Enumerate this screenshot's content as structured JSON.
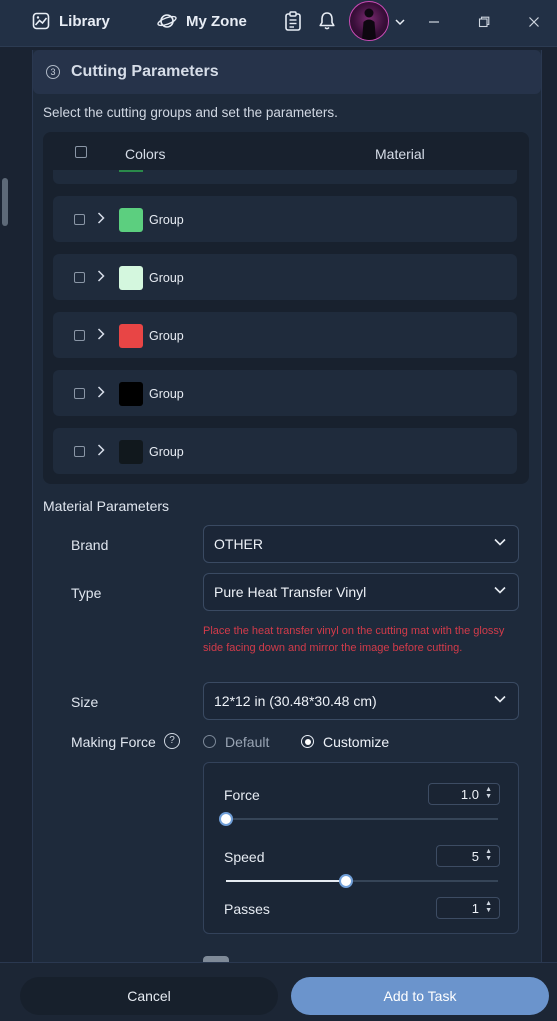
{
  "header": {
    "library_label": "Library",
    "my_zone_label": "My Zone"
  },
  "section": {
    "step_number": "3",
    "title": "Cutting Parameters",
    "description": "Select the cutting groups and set the parameters."
  },
  "table": {
    "col_colors": "Colors",
    "col_material": "Material",
    "groups": [
      {
        "label": "Group",
        "color": "#5ccf7f"
      },
      {
        "label": "Group",
        "color": "#d4f7de"
      },
      {
        "label": "Group",
        "color": "#e84545"
      },
      {
        "label": "Group",
        "color": "#000000"
      },
      {
        "label": "Group",
        "color": "#11181d"
      }
    ]
  },
  "material": {
    "title": "Material Parameters",
    "brand_label": "Brand",
    "brand_value": "OTHER",
    "type_label": "Type",
    "type_value": "Pure Heat Transfer Vinyl",
    "warning": "Place the heat transfer vinyl on the cutting mat with the glossy side facing down and mirror the image before cutting.",
    "size_label": "Size",
    "size_value": "12*12 in (30.48*30.48 cm)",
    "making_force_label": "Making Force",
    "help_glyph": "?",
    "option_default": "Default",
    "option_customize": "Customize",
    "selected_option": "Customize"
  },
  "force_settings": {
    "force_label": "Force",
    "force_value": "1.0",
    "force_slider_fraction": 0.0,
    "speed_label": "Speed",
    "speed_value": "5",
    "speed_slider_fraction": 0.44,
    "passes_label": "Passes",
    "passes_value": "1"
  },
  "footer": {
    "cancel_label": "Cancel",
    "add_label": "Add to Task"
  },
  "colors": {
    "accent": "#6b94cc",
    "warning": "#d23b4a"
  }
}
